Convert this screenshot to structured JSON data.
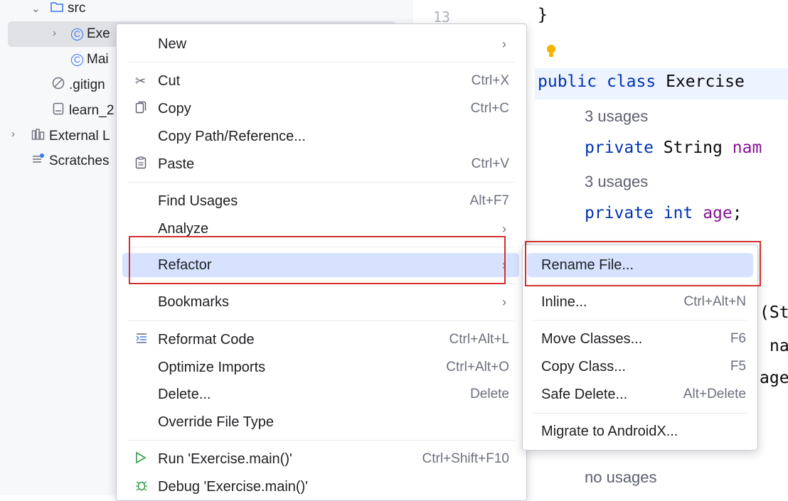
{
  "tree": {
    "items": [
      {
        "label": "src",
        "icon": "folder-icon"
      },
      {
        "label": "Exe",
        "icon": "class-icon"
      },
      {
        "label": "Mai",
        "icon": "class-icon"
      },
      {
        "label": ".gitign",
        "icon": "ignored-file-icon"
      },
      {
        "label": "learn_2",
        "icon": "file-icon"
      },
      {
        "label": "External L",
        "icon": "library-icon"
      },
      {
        "label": "Scratches",
        "icon": "scratches-icon"
      }
    ]
  },
  "editor": {
    "line_number": "13",
    "closing_brace": "}",
    "class_decl": {
      "kw1": "public",
      "kw2": "class",
      "name": "Exercise"
    },
    "usages_1": "3 usages",
    "field1": {
      "kw": "private",
      "type": "String",
      "name": "nam"
    },
    "usages_2": "3 usages",
    "field2": {
      "kw": "private",
      "type": "int",
      "name": "age",
      "end": ";"
    },
    "frag1": "(St",
    "frag2": "na",
    "frag3": "age",
    "no_usages": "no usages"
  },
  "context_menu": {
    "new": {
      "label": "New"
    },
    "cut": {
      "label": "Cut",
      "shortcut": "Ctrl+X"
    },
    "copy": {
      "label": "Copy",
      "shortcut": "Ctrl+C"
    },
    "copy_path": {
      "label": "Copy Path/Reference..."
    },
    "paste": {
      "label": "Paste",
      "shortcut": "Ctrl+V"
    },
    "find_usages": {
      "label": "Find Usages",
      "shortcut": "Alt+F7"
    },
    "analyze": {
      "label": "Analyze"
    },
    "refactor": {
      "label": "Refactor"
    },
    "bookmarks": {
      "label": "Bookmarks"
    },
    "reformat": {
      "label": "Reformat Code",
      "shortcut": "Ctrl+Alt+L"
    },
    "optimize": {
      "label": "Optimize Imports",
      "shortcut": "Ctrl+Alt+O"
    },
    "delete": {
      "label": "Delete...",
      "shortcut": "Delete"
    },
    "override": {
      "label": "Override File Type"
    },
    "run": {
      "label": "Run 'Exercise.main()'",
      "shortcut": "Ctrl+Shift+F10"
    },
    "debug": {
      "label": "Debug 'Exercise.main()'"
    }
  },
  "submenu": {
    "rename_file": {
      "label": "Rename File..."
    },
    "inline": {
      "label": "Inline...",
      "shortcut": "Ctrl+Alt+N"
    },
    "move_classes": {
      "label": "Move Classes...",
      "shortcut": "F6"
    },
    "copy_class": {
      "label": "Copy Class...",
      "shortcut": "F5"
    },
    "safe_delete": {
      "label": "Safe Delete...",
      "shortcut": "Alt+Delete"
    },
    "migrate": {
      "label": "Migrate to AndroidX..."
    }
  },
  "colors": {
    "highlight_box": "#d0312d",
    "active_item": "#d6e2ff",
    "accent": "#3574f0"
  }
}
